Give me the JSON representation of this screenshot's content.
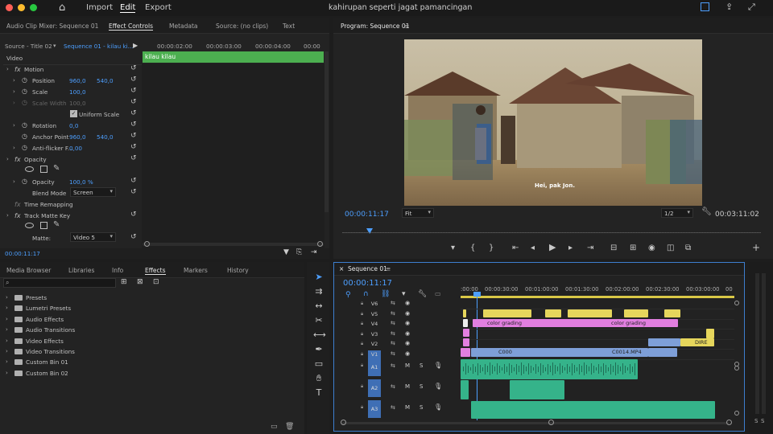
{
  "app": {
    "title": "kahirupan seperti jagat pamancingan",
    "menu": [
      "Import",
      "Edit",
      "Export"
    ],
    "active_menu": "Edit"
  },
  "source_panel": {
    "tabs": [
      "Audio Clip Mixer: Sequence 01",
      "Effect Controls",
      "Metadata",
      "Source: (no clips)",
      "Text"
    ],
    "active_tab": "Effect Controls",
    "source_label": "Source - Title 02",
    "sequence_label": "Sequence 01 - kilau ki...",
    "ruler": [
      "00:00:02:00",
      "00:00:03:00",
      "00:00:04:00",
      "00:00"
    ],
    "clip_name": "kilau kilau",
    "section": "Video",
    "motion": "Motion",
    "props": [
      {
        "name": "Position",
        "v1": "960,0",
        "v2": "540,0"
      },
      {
        "name": "Scale",
        "v1": "100,0",
        "v2": ""
      },
      {
        "name": "Scale Width",
        "v1": "100,0",
        "v2": ""
      },
      {
        "name": "Uniform Scale",
        "v1": "",
        "v2": ""
      },
      {
        "name": "Rotation",
        "v1": "0,0",
        "v2": ""
      },
      {
        "name": "Anchor Point",
        "v1": "960,0",
        "v2": "540,0"
      },
      {
        "name": "Anti-flicker F...",
        "v1": "0,00",
        "v2": ""
      }
    ],
    "opacity": "Opacity",
    "opacity_value": "100,0 %",
    "blend_label": "Blend Mode",
    "blend_value": "Screen",
    "time_remap": "Time Remapping",
    "track_matte": "Track Matte Key",
    "matte_label": "Matte:",
    "matte_value": "Video 5",
    "timecode": "00:00:11:17"
  },
  "program": {
    "title": "Program: Sequence 01",
    "subtitle": "Hei, pak Jon.",
    "timecode": "00:00:11:17",
    "fit": "Fit",
    "resolution": "1/2",
    "duration": "00:03:11:02"
  },
  "project": {
    "tabs": [
      "Media Browser",
      "Libraries",
      "Info",
      "Effects",
      "Markers",
      "History"
    ],
    "active_tab": "Effects",
    "bins": [
      "Presets",
      "Lumetri Presets",
      "Audio Effects",
      "Audio Transitions",
      "Video Effects",
      "Video Transitions",
      "Custom Bin 01",
      "Custom Bin 02"
    ]
  },
  "timeline": {
    "title": "Sequence 01",
    "timecode": "00:00:11:17",
    "ruler": [
      ":00:00",
      "00:00:30:00",
      "00:01:00:00",
      "00:01:30:00",
      "00:02:00:00",
      "00:02:30:00",
      "00:03:00:00",
      "00"
    ],
    "video_tracks": [
      "V6",
      "V5",
      "V4",
      "V3",
      "V2",
      "V1"
    ],
    "audio_tracks": [
      "A1",
      "A2",
      "A3"
    ],
    "clip_labels": {
      "cg1": "color grading",
      "cg2": "color grading",
      "c1": "C000",
      "c2": "C0014.MP4",
      "dire": "DIRE"
    },
    "audio_meter": [
      "S",
      "S"
    ]
  },
  "colors": {
    "accent": "#4d9fff",
    "video_clip": "#7e9fd8",
    "title_clip": "#e27fe0",
    "yellow_clip": "#e6d65c",
    "audio_clip": "#35b38a",
    "green_clip": "#4caf50"
  }
}
